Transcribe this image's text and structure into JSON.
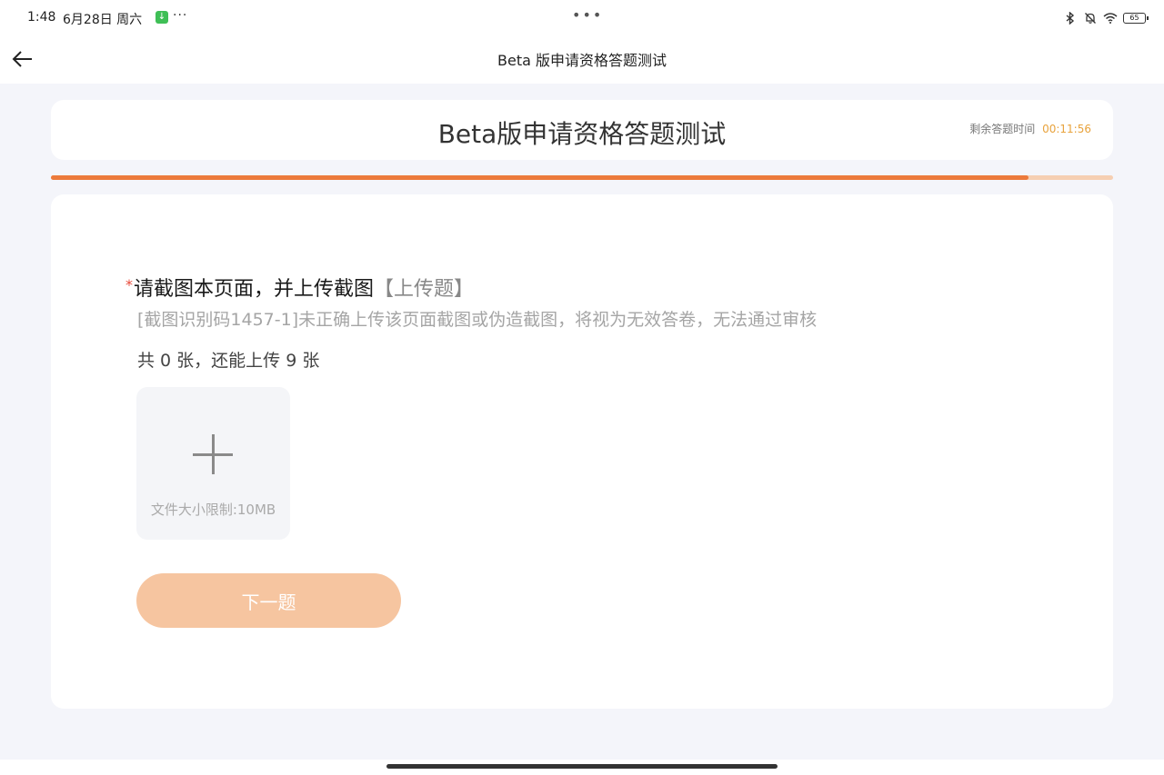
{
  "status_bar": {
    "time": "1:48",
    "date": "6月28日 周六",
    "overflow": "···",
    "center_dots": "•••",
    "battery": "65",
    "icons": [
      "download-icon",
      "bluetooth-icon",
      "mute-bell-icon",
      "wifi-icon",
      "battery-icon"
    ]
  },
  "nav": {
    "title": "Beta 版申请资格答题测试",
    "back_icon": "arrow-left-icon"
  },
  "header": {
    "title": "Beta版申请资格答题测试",
    "timer_label": "剩余答题时间",
    "timer_value": "00:11:56"
  },
  "progress": {
    "fraction": 0.92,
    "fill_color": "#ec7a3b",
    "track_color": "#f6cfb2"
  },
  "question": {
    "required_mark": "*",
    "title": "请截图本页面，并上传截图",
    "type": "【上传题】",
    "note": "[截图识别码1457-1]未正确上传该页面截图或伪造截图，将视为无效答卷，无法通过审核",
    "count_text": "共 0 张，还能上传 9 张",
    "upload_limit": "文件大小限制:10MB"
  },
  "actions": {
    "next_label": "下一题",
    "accent_color": "#f6c5a0"
  }
}
